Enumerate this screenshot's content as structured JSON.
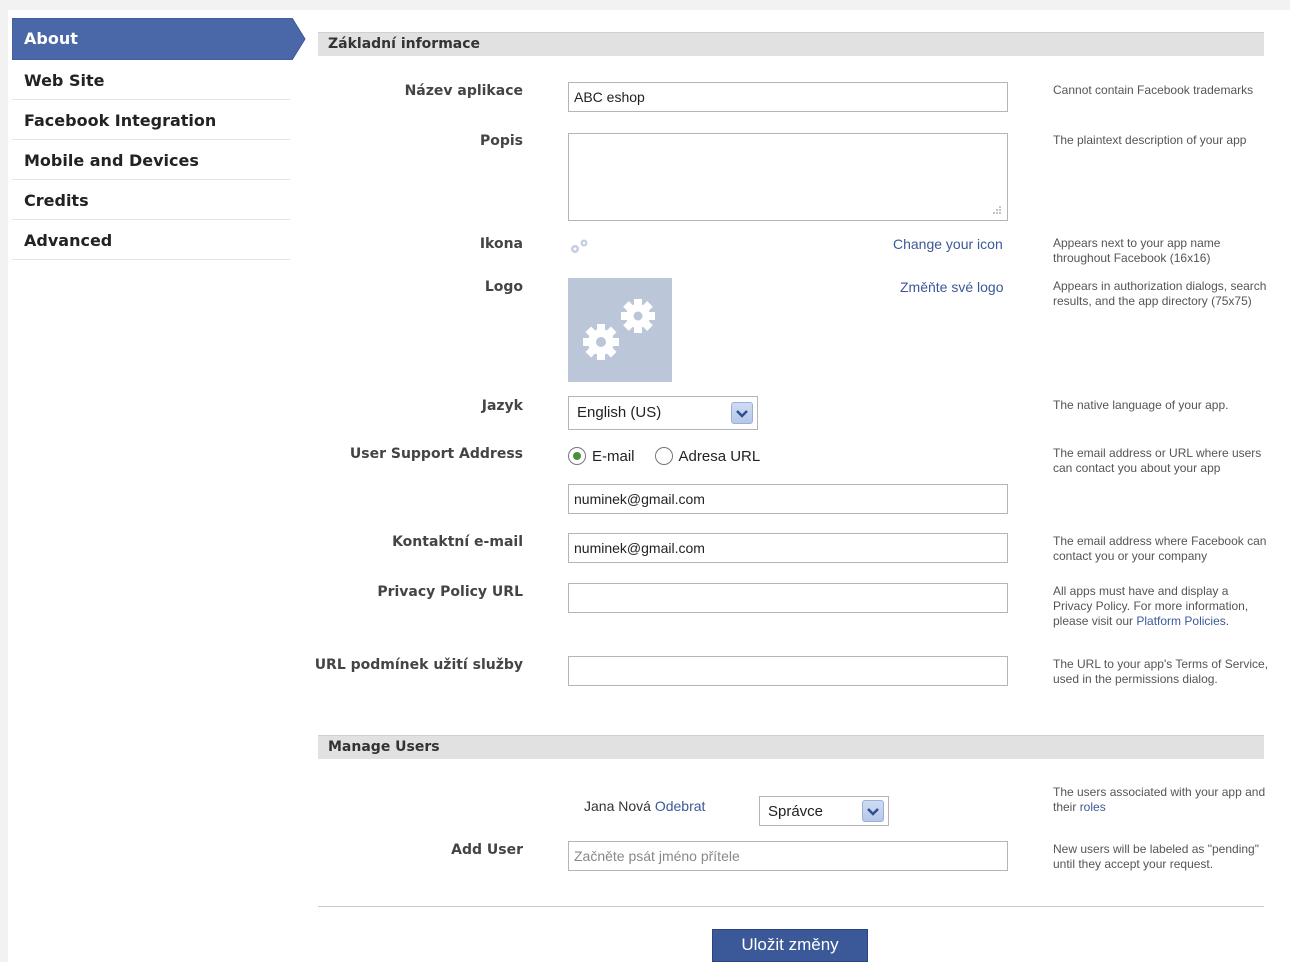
{
  "sidebar": {
    "items": [
      {
        "label": "About",
        "active": true
      },
      {
        "label": "Web Site"
      },
      {
        "label": "Facebook Integration"
      },
      {
        "label": "Mobile and Devices"
      },
      {
        "label": "Credits"
      },
      {
        "label": "Advanced"
      }
    ]
  },
  "basic": {
    "section_title": "Základní informace",
    "app_name": {
      "label": "Název aplikace",
      "value": "ABC eshop",
      "help": "Cannot contain Facebook trademarks"
    },
    "description": {
      "label": "Popis",
      "value": "",
      "help": "The plaintext description of your app"
    },
    "icon": {
      "label": "Ikona",
      "action": "Change your icon",
      "help": "Appears next to your app name throughout Facebook (16x16)",
      "icon_name": "gears-icon"
    },
    "logo": {
      "label": "Logo",
      "action": "Změňte své logo",
      "help": "Appears in authorization dialogs, search results, and the app directory (75x75)",
      "icon_name": "gears-icon"
    },
    "language": {
      "label": "Jazyk",
      "value": "English (US)",
      "help": "The native language of your app."
    },
    "support": {
      "label": "User Support Address",
      "option_email": "E-mail",
      "option_url": "Adresa URL",
      "selected": "E-mail",
      "value": "numinek@gmail.com",
      "help": "The email address or URL where users can contact you about your app"
    },
    "contact": {
      "label": "Kontaktní e-mail",
      "value": "numinek@gmail.com",
      "help": "The email address where Facebook can contact you or your company"
    },
    "privacy": {
      "label": "Privacy Policy URL",
      "value": "",
      "help_prefix": "All apps must have and display a Privacy Policy. For more information, please visit our ",
      "help_link": "Platform Policies",
      "help_suffix": "."
    },
    "tos": {
      "label": "URL podmínek užití služby",
      "value": "",
      "help": "The URL to your app's Terms of Service, used in the permissions dialog."
    }
  },
  "users": {
    "section_title": "Manage Users",
    "user_name": "Jana Nová",
    "remove_label": "Odebrat",
    "role_value": "Správce",
    "help_prefix": "The users associated with your app and their ",
    "help_link": "roles",
    "add_user": {
      "label": "Add User",
      "placeholder": "Začněte psát jméno přítele",
      "help": "New users will be labeled as \"pending\" until they accept your request."
    }
  },
  "save_label": "Uložit změny",
  "colors": {
    "accent": "#3b5998",
    "logo_bg": "#bcc6d9",
    "header_bg": "#e1e1e1"
  }
}
